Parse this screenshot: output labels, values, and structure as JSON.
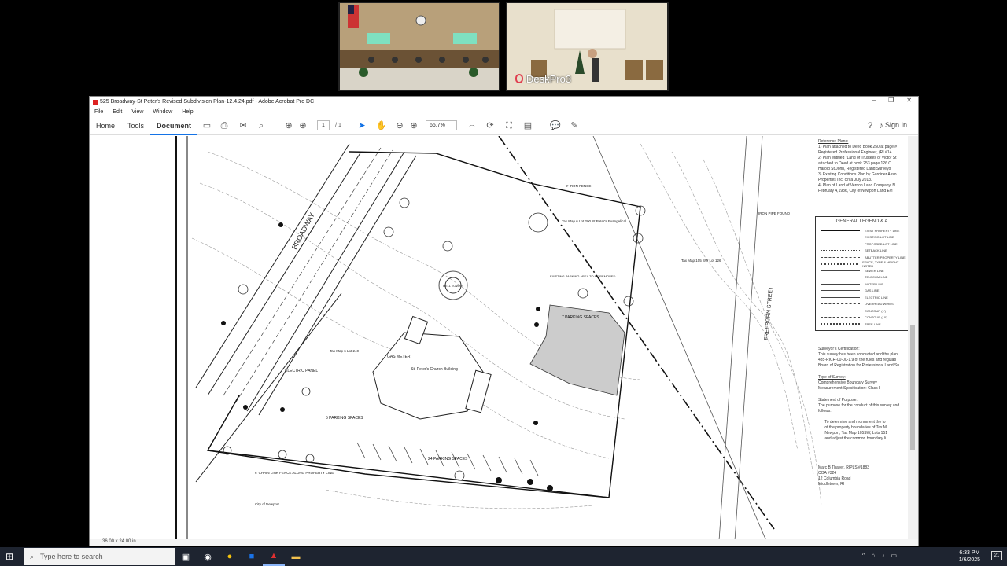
{
  "video": {
    "tile1_label": "",
    "tile2_label": "DeskPro3"
  },
  "window": {
    "title": "525 Broadway-St Peter's Revised Subdivision Plan-12.4.24.pdf - Adobe Acrobat Pro DC",
    "menu": [
      "File",
      "Edit",
      "View",
      "Window",
      "Help"
    ]
  },
  "toolbar": {
    "home": "Home",
    "tools": "Tools",
    "document": "Document",
    "page_current": "1",
    "page_total": "/ 1",
    "zoom": "66.7%",
    "signin": "Sign In"
  },
  "status": {
    "page_size": "36.00 x 24.00 in"
  },
  "plan": {
    "reference_title": "Reference Plans:",
    "reference_lines": [
      "1) Plan attached to Deed Book 250 at page #",
      "   Registered Professional Engineer, (RI #14",
      "2) Plan entitled \"Land of Trustees of Victor St",
      "   attached to Deed at book 253 page 126 C",
      "   Harold St John, Registered Land Surveyo",
      "3) Existing Conditions Plan by Gardiner Asso",
      "   Properties Inc. circa July 2013.",
      "4) Plan of Land of Vernon Land Company, N",
      "   February 4,1936, City of Newport Land Evi"
    ],
    "legend_title": "GENERAL LEGEND & A",
    "legend_items": [
      "EXIST PROPERTY LINE",
      "EXISTING LOT LINE",
      "PROPOSED LOT LINE",
      "SETBACK LINE",
      "ABUTTER PROPERTY LINE",
      "FENCE, TYPE & HEIGHT NOTED",
      "SEWER LINE",
      "TELECOM LINE",
      "WATER LINE",
      "GAS LINE",
      "ELECTRIC LINE",
      "OVERHEAD WIRES",
      "CONTOUR (1')",
      "CONTOUR (10')",
      "TREE LINE"
    ],
    "surveyor_title": "Surveyor's Certification:",
    "surveyor_lines": [
      "This survey has been conducted and the plan",
      "435-RICR-00-00-1.9 of the rules and regulati",
      "Board of Registration for Professional Land Su"
    ],
    "type_title": "Type of Survey:",
    "type_lines": [
      "Comprehensive Boundary Survey",
      "Measurement Specification:  Class I"
    ],
    "purpose_title": "Statement of Purpose:",
    "purpose_lines": [
      "The purpose for the conduct of this survey and",
      "follows:",
      "",
      "      To determine and monument the lo",
      "      of the property boundaries of Tax M",
      "      Newport, Tax Map 105SW, Lots 151",
      "      and adjust the common boundary li"
    ],
    "signature_lines": [
      "Marc B Thayer, RIPLS #1883",
      "COA #324",
      "12 Columbia Road",
      "Middletown, RI"
    ],
    "street_broadway": "BROADWAY",
    "street_freeborn": "FREEBORN STREET",
    "labels": {
      "church": "St. Peter's Church Building",
      "parking_7": "7 PARKING SPACES",
      "parking_24": "24 PARKING SPACES",
      "parking_5": "5 PARKING SPACES",
      "existing_parking": "EXISTING PARKING AREA TO BE REMOVED",
      "bell_tower": "BELL TOWER",
      "gas_meter": "GAS METER",
      "electric_panel": "ELECTRIC PANEL",
      "iron_fence": "8' IRON FENCE",
      "iron_pipe": "IRON PIPE FOUND",
      "city_newport": "City of Newport",
      "chain_link": "6' CHAIN LINK FENCE ALONG PROPERTY LINE",
      "lot_200": "Tax Map 6  Lot 200  St Peter's Evangelical",
      "lot_126": "Tax Map 105 SW  Lot 126",
      "lot_240": "Tax Map 6 Lot 240"
    }
  },
  "taskbar": {
    "search_placeholder": "Type here to search",
    "time": "6:33 PM",
    "date": "1/6/2025",
    "notifications": "21"
  }
}
